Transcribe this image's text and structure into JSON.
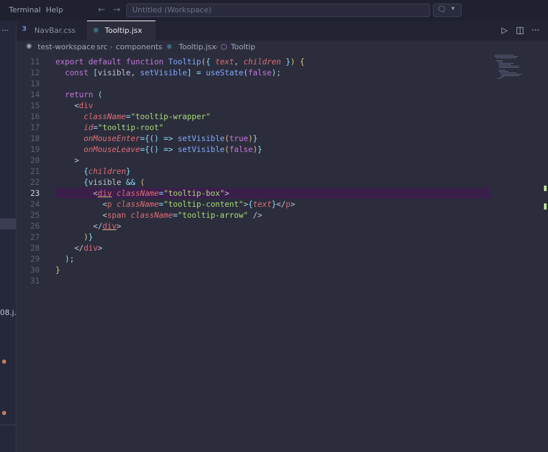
{
  "menu": {
    "terminal": "Terminal",
    "help": "Help"
  },
  "search": {
    "placeholder": "Untitled (Workspace)"
  },
  "sidebar": {
    "dots": "···",
    "file_fragment": "08.j..."
  },
  "tabs": [
    {
      "label": "NavBar.css",
      "icon": "css-icon"
    },
    {
      "label": "Tooltip.jsx",
      "icon": "react-icon"
    }
  ],
  "tabbar_actions": {
    "more": "···"
  },
  "breadcrumb": [
    "test-workspace",
    "src",
    "components",
    "Tooltip.jsx",
    "Tooltip"
  ],
  "editor": {
    "active_line": 23,
    "lines": [
      {
        "n": "11",
        "html": "<span class=\"kw\">export</span> <span class=\"kw\">default</span> <span class=\"kw\">function</span> <span class=\"fn\">Tooltip</span><span class=\"br\">(</span><span class=\"op\">{</span> <span class=\"pr\">text</span>, <span class=\"pr\">children</span> <span class=\"op\">}</span><span class=\"br\">)</span> <span class=\"br\">{</span>"
      },
      {
        "n": "12",
        "html": "  <span class=\"kw\">const</span> <span class=\"op\">[</span>visible, <span class=\"fn\">setVisible</span><span class=\"op\">]</span> <span class=\"op\">=</span> <span class=\"fn\">useState</span><span class=\"op\">(</span><span class=\"kw\">false</span><span class=\"op\">)</span>;"
      },
      {
        "n": "13",
        "html": ""
      },
      {
        "n": "14",
        "html": "  <span class=\"kw\">return</span> <span class=\"op\">(</span>"
      },
      {
        "n": "15",
        "html": "    <span class=\"pn\">&lt;</span><span class=\"tg\">div</span>"
      },
      {
        "n": "16",
        "html": "      <span class=\"at\">className</span><span class=\"op\">=</span><span class=\"st\">\"tooltip-wrapper\"</span>"
      },
      {
        "n": "17",
        "html": "      <span class=\"at\">id</span><span class=\"op\">=</span><span class=\"st\">\"tooltip-root\"</span>"
      },
      {
        "n": "18",
        "html": "      <span class=\"at\">onMouseEnter</span><span class=\"op\">=</span><span class=\"op\">{</span><span class=\"op\">()</span> <span class=\"op\">=&gt;</span> <span class=\"fn\">setVisible</span><span class=\"br\">(</span><span class=\"kw\">true</span><span class=\"br\">)</span><span class=\"op\">}</span>"
      },
      {
        "n": "19",
        "html": "      <span class=\"at\">onMouseLeave</span><span class=\"op\">=</span><span class=\"op\">{</span><span class=\"op\">()</span> <span class=\"op\">=&gt;</span> <span class=\"fn\">setVisible</span><span class=\"br\">(</span><span class=\"kw\">false</span><span class=\"br\">)</span><span class=\"op\">}</span>"
      },
      {
        "n": "20",
        "html": "    <span class=\"pn\">&gt;</span>"
      },
      {
        "n": "21",
        "html": "      <span class=\"op\">{</span><span class=\"pr\">children</span><span class=\"op\">}</span>"
      },
      {
        "n": "22",
        "html": "      <span class=\"op\">{</span>visible <span class=\"op\">&amp;&amp;</span> <span class=\"br\">(</span>"
      },
      {
        "n": "23",
        "html": "        <span class=\"pn\">&lt;</span><span class=\"tg ul\">div</span> <span class=\"at\">className</span><span class=\"op\">=</span><span class=\"st\">\"tooltip-box\"</span><span class=\"pn\">&gt;</span>"
      },
      {
        "n": "24",
        "html": "          <span class=\"pn\">&lt;</span><span class=\"tg\">p</span> <span class=\"at\">className</span><span class=\"op\">=</span><span class=\"st\">\"tooltip-content\"</span><span class=\"pn\">&gt;</span><span class=\"op\">{</span><span class=\"pr\">text</span><span class=\"op\">}</span><span class=\"pn\">&lt;/</span><span class=\"tg\">p</span><span class=\"pn\">&gt;</span>"
      },
      {
        "n": "25",
        "html": "          <span class=\"pn\">&lt;</span><span class=\"tg\">span</span> <span class=\"at\">className</span><span class=\"op\">=</span><span class=\"st\">\"tooltip-arrow\"</span> <span class=\"pn\">/&gt;</span>"
      },
      {
        "n": "26",
        "html": "        <span class=\"pn\">&lt;/</span><span class=\"tg ul\">div</span><span class=\"pn\">&gt;</span>"
      },
      {
        "n": "27",
        "html": "      <span class=\"br\">)</span><span class=\"op\">}</span>"
      },
      {
        "n": "28",
        "html": "    <span class=\"pn\">&lt;/</span><span class=\"tg\">div</span><span class=\"pn\">&gt;</span>"
      },
      {
        "n": "29",
        "html": "  <span class=\"op\">)</span>;"
      },
      {
        "n": "30",
        "html": "<span class=\"br\">}</span>"
      },
      {
        "n": "31",
        "html": ""
      }
    ]
  },
  "colors": {
    "background": "#2b2d3c",
    "keyword": "#c678dd",
    "function": "#82aaff",
    "string": "#a9dc76",
    "tag": "#e06c75",
    "current_line": "#3a1f4a"
  }
}
